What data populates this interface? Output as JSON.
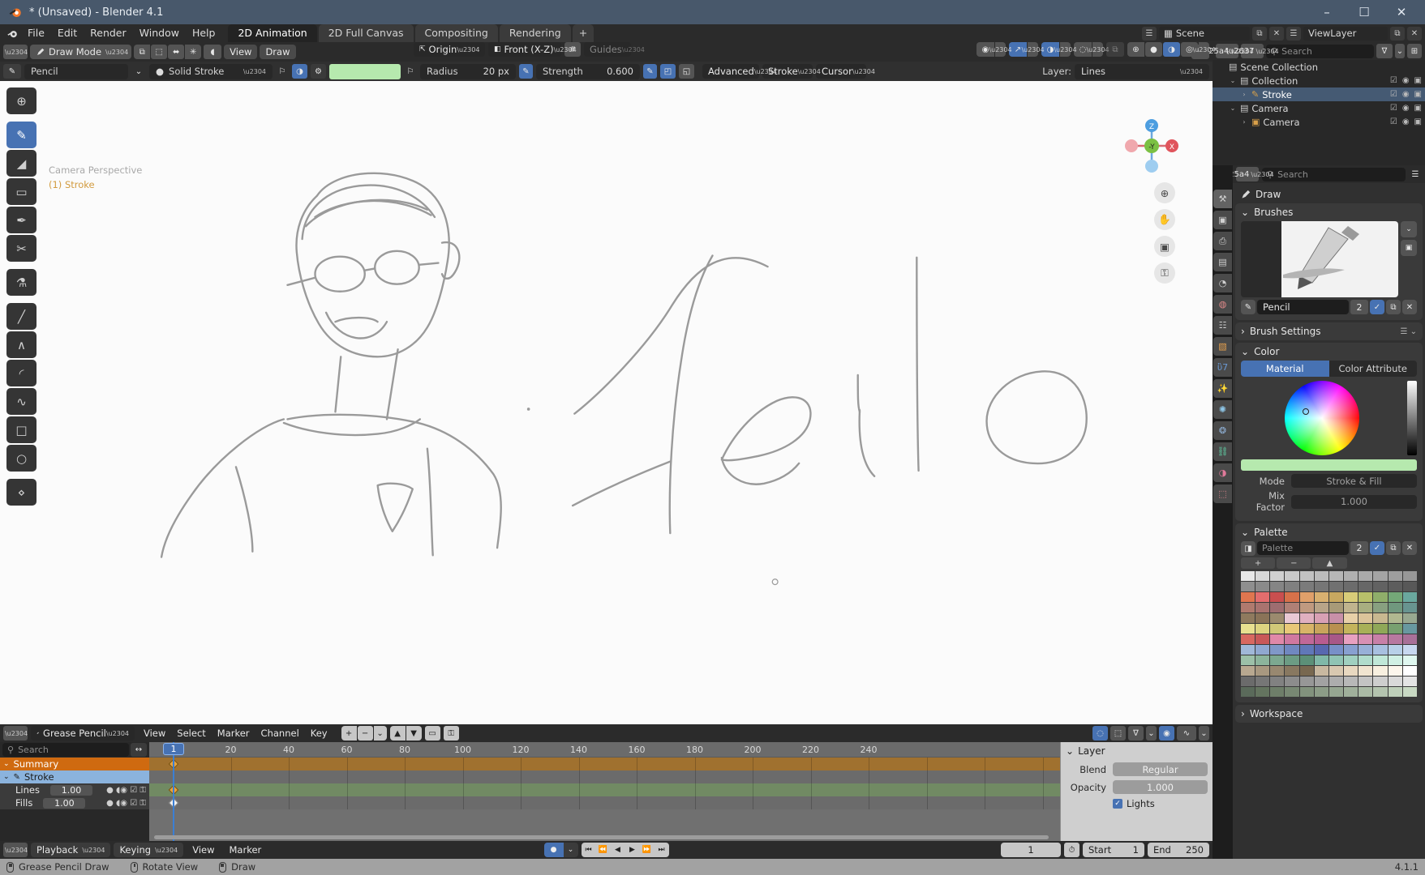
{
  "window": {
    "title": "* (Unsaved) - Blender 4.1",
    "minimize": "–",
    "maximize": "☐",
    "close": "✕"
  },
  "topbar": {
    "menus": [
      "File",
      "Edit",
      "Render",
      "Window",
      "Help"
    ],
    "workspaces": [
      {
        "label": "2D Animation",
        "active": true
      },
      {
        "label": "2D Full Canvas",
        "active": false
      },
      {
        "label": "Compositing",
        "active": false
      },
      {
        "label": "Rendering",
        "active": false
      }
    ],
    "add_tab": "+",
    "scene_label": "Scene",
    "viewlayer_label": "ViewLayer"
  },
  "viewport_header": {
    "mode": "Draw Mode",
    "menus": [
      "View",
      "Draw"
    ],
    "orientation": "Origin",
    "view_axis": "Front (X-Z)",
    "guides": "Guides"
  },
  "tool_settings": {
    "brush_name": "Pencil",
    "material": "Solid Stroke",
    "material_color": "#b6e9ae",
    "radius_label": "Radius",
    "radius_value": "20 px",
    "strength_label": "Strength",
    "strength_value": "0.600",
    "advanced": "Advanced",
    "stroke": "Stroke",
    "cursor": "Cursor",
    "layer_label": "Layer:",
    "layer_value": "Lines"
  },
  "viewport": {
    "camera_label": "Camera Perspective",
    "stroke_label": "(1) Stroke",
    "gizmo": {
      "x": "X",
      "y": "-Y",
      "z": "Z"
    },
    "tools": [
      {
        "name": "tweak-tool",
        "glyph": "⊕",
        "selected": false
      },
      {
        "name": "draw-tool",
        "glyph": "✎",
        "selected": true
      },
      {
        "name": "fill-tool",
        "glyph": "◢",
        "selected": false
      },
      {
        "name": "erase-tool",
        "glyph": "▭",
        "selected": false
      },
      {
        "name": "tint-tool",
        "glyph": "✒",
        "selected": false
      },
      {
        "name": "cutter-tool",
        "glyph": "✂",
        "selected": false
      },
      {
        "name": "eyedropper-tool",
        "glyph": "⚗",
        "selected": false
      },
      {
        "name": "line-tool",
        "glyph": "╱",
        "selected": false
      },
      {
        "name": "polyline-tool",
        "glyph": "∧",
        "selected": false
      },
      {
        "name": "arc-tool",
        "glyph": "◜",
        "selected": false
      },
      {
        "name": "curve-tool",
        "glyph": "∿",
        "selected": false
      },
      {
        "name": "box-tool",
        "glyph": "□",
        "selected": false
      },
      {
        "name": "circle-tool",
        "glyph": "○",
        "selected": false
      },
      {
        "name": "interpolate-tool",
        "glyph": "⋄",
        "selected": false
      }
    ],
    "nav_buttons": [
      {
        "name": "zoom-icon",
        "glyph": "⊕"
      },
      {
        "name": "pan-hand-icon",
        "glyph": "✋"
      },
      {
        "name": "camera-view-icon",
        "glyph": "▣"
      },
      {
        "name": "lock-toggle-icon",
        "glyph": "⚿"
      }
    ]
  },
  "outliner": {
    "search_placeholder": "Search",
    "rows": [
      {
        "label": "Scene Collection",
        "indent": 0,
        "icon": "collection-icon",
        "selected": false,
        "expand": ""
      },
      {
        "label": "Collection",
        "indent": 1,
        "icon": "collection-icon",
        "selected": false,
        "expand": "⌄"
      },
      {
        "label": "Stroke",
        "indent": 2,
        "icon": "grease-pencil-icon",
        "selected": true,
        "expand": "›"
      },
      {
        "label": "Camera",
        "indent": 1,
        "icon": "collection-icon",
        "selected": false,
        "expand": "⌄"
      },
      {
        "label": "Camera",
        "indent": 2,
        "icon": "camera-icon",
        "selected": false,
        "expand": "›"
      }
    ]
  },
  "properties": {
    "search_placeholder": "Search",
    "breadcrumb": "Draw",
    "panels": {
      "brushes": "Brushes",
      "brush_settings": "Brush Settings",
      "color": "Color",
      "palette": "Palette",
      "workspace": "Workspace"
    },
    "brush": {
      "name": "Pencil",
      "users": "2"
    },
    "color": {
      "tab_material": "Material",
      "tab_attribute": "Color Attribute",
      "current": "#b6e9ae",
      "mode_label": "Mode",
      "mode_value": "Stroke & Fill",
      "mix_label": "Mix Factor",
      "mix_value": "1.000"
    },
    "palette": {
      "name": "Palette",
      "users": "2",
      "add": "+",
      "remove": "−",
      "sort": "▲",
      "swatches": [
        [
          "#e8e8e8",
          "#d8d8d8",
          "#d0d0d0",
          "#c9c9c9",
          "#c2c2c2",
          "#bcbcbc",
          "#b6b6b6",
          "#b0b0b0",
          "#aaaaaa",
          "#a4a4a4",
          "#9e9e9e",
          "#989898"
        ],
        [
          "#8f8f8f",
          "#8a8a8a",
          "#858585",
          "#808080",
          "#7b7b7b",
          "#767676",
          "#717171",
          "#6c6c6c",
          "#676767",
          "#626262",
          "#5d5d5d",
          "#585858"
        ],
        [
          "#e0764f",
          "#e36d6d",
          "#c94f4f",
          "#d6714a",
          "#e0a06a",
          "#d8b070",
          "#c8a860",
          "#d8cc78",
          "#b8c06a",
          "#8fae6a",
          "#74a878",
          "#6aa89e"
        ],
        [
          "#b07a6e",
          "#a9736f",
          "#9e6d70",
          "#b08076",
          "#c09a80",
          "#b8a488",
          "#a89a78",
          "#c0b48e",
          "#a8ae80",
          "#88a080",
          "#70987e",
          "#689490"
        ],
        [
          "#8f7a5e",
          "#8a7358",
          "#9b8a6e",
          "#e8c8d4",
          "#e0b0c0",
          "#d8a0b4",
          "#c890a8",
          "#e8d0a8",
          "#dcc49a",
          "#c8b890",
          "#b0b890",
          "#98a890"
        ],
        [
          "#e8e090",
          "#ddd480",
          "#d0c878",
          "#e8c878",
          "#d8b468",
          "#c8a45c",
          "#b89050",
          "#c4b45c",
          "#a8b058",
          "#8fa858",
          "#78a070",
          "#6898a0"
        ],
        [
          "#d86860",
          "#c85858",
          "#e088a8",
          "#d078a0",
          "#c06898",
          "#b85c90",
          "#a85888",
          "#e8a0c0",
          "#d890b4",
          "#c880a8",
          "#b878a0",
          "#a87098"
        ],
        [
          "#a0b8d8",
          "#90a8d0",
          "#8098c8",
          "#7088c0",
          "#6078b8",
          "#5868b0",
          "#7890c8",
          "#88a0d0",
          "#98b0d8",
          "#a8c0e0",
          "#b8d0e8",
          "#c8d8f0"
        ],
        [
          "#9cc0a8",
          "#8cb49c",
          "#7ca890",
          "#6c9c84",
          "#5c9078",
          "#80b8a8",
          "#90c4b4",
          "#a0d0c0",
          "#b0dccc",
          "#c0e8d8",
          "#d0f0e4",
          "#e0f8f0"
        ],
        [
          "#b8a890",
          "#a89880",
          "#988870",
          "#887860",
          "#786850",
          "#c8b8a0",
          "#d8c8b0",
          "#e8d8c0",
          "#f0e4d0",
          "#f8f0e0",
          "#fcf6ec",
          "#ffffff"
        ],
        [
          "#6b6b6b",
          "#767676",
          "#818181",
          "#8c8c8c",
          "#979797",
          "#a2a2a2",
          "#adadad",
          "#b8b8b8",
          "#c3c3c3",
          "#cecece",
          "#d9d9d9",
          "#e4e4e4"
        ],
        [
          "#5a6a5a",
          "#64745f",
          "#6e7e69",
          "#788873",
          "#82927d",
          "#8c9c87",
          "#96a691",
          "#a0b09b",
          "#aabaa5",
          "#b4c4af",
          "#becfb9",
          "#c8d9c3"
        ]
      ]
    },
    "tabs": [
      {
        "name": "tool-tab",
        "glyph": "⚒",
        "on": true
      },
      {
        "name": "render-tab",
        "glyph": "▣",
        "on": false
      },
      {
        "name": "output-tab",
        "glyph": "⎙",
        "on": false
      },
      {
        "name": "view-layer-tab",
        "glyph": "▤",
        "on": false
      },
      {
        "name": "scene-tab",
        "glyph": "◔",
        "on": false
      },
      {
        "name": "world-tab",
        "glyph": "◍",
        "on": false
      },
      {
        "name": "collection-tab",
        "glyph": "☷",
        "on": false
      },
      {
        "name": "object-tab",
        "glyph": "▧",
        "on": false
      },
      {
        "name": "modifiers-tab",
        "glyph": "ὒ7",
        "on": false
      },
      {
        "name": "effects-tab",
        "glyph": "✨",
        "on": false
      },
      {
        "name": "particles-tab",
        "glyph": "✺",
        "on": false
      },
      {
        "name": "physics-tab",
        "glyph": "❂",
        "on": false
      },
      {
        "name": "constraints-tab",
        "glyph": "⛓",
        "on": false
      },
      {
        "name": "data-tab",
        "glyph": "◑",
        "on": false
      },
      {
        "name": "material-tab",
        "glyph": "⬚",
        "on": false
      }
    ]
  },
  "dopesheet": {
    "editor_name": "Grease Pencil",
    "menus": [
      "View",
      "Select",
      "Marker",
      "Channel",
      "Key"
    ],
    "search_placeholder": "Search",
    "channels": [
      {
        "label": "Summary",
        "type": "summary",
        "value": null
      },
      {
        "label": "Stroke",
        "type": "object",
        "value": null
      },
      {
        "label": "Lines",
        "type": "layer",
        "value": "1.00"
      },
      {
        "label": "Fills",
        "type": "layer",
        "value": "1.00"
      }
    ],
    "ruler_ticks": [
      "20",
      "40",
      "60",
      "80",
      "100",
      "120",
      "140",
      "160",
      "180",
      "200",
      "220",
      "240"
    ],
    "current_frame": "1",
    "layer_panel": {
      "title": "Layer",
      "blend_label": "Blend",
      "blend_value": "Regular",
      "opacity_label": "Opacity",
      "opacity_value": "1.000",
      "lights_label": "Lights",
      "lights_checked": true
    }
  },
  "timeline": {
    "playback": "Playback",
    "keying": "Keying",
    "menus": [
      "View",
      "Marker"
    ],
    "transport": [
      {
        "name": "jump-start-button",
        "glyph": "⏮"
      },
      {
        "name": "prev-keyframe-button",
        "glyph": "⏪"
      },
      {
        "name": "play-reverse-button",
        "glyph": "◀"
      },
      {
        "name": "play-button",
        "glyph": "▶"
      },
      {
        "name": "next-keyframe-button",
        "glyph": "⏩"
      },
      {
        "name": "jump-end-button",
        "glyph": "⏭"
      }
    ],
    "frame_value": "1",
    "start_label": "Start",
    "start_value": "1",
    "end_label": "End",
    "end_value": "250"
  },
  "statusbar": {
    "items": [
      {
        "mouse": "left",
        "label": "Grease Pencil Draw"
      },
      {
        "mouse": "middle",
        "label": "Rotate View"
      },
      {
        "mouse": "right",
        "label": "Draw"
      }
    ],
    "version": "4.1.1"
  }
}
